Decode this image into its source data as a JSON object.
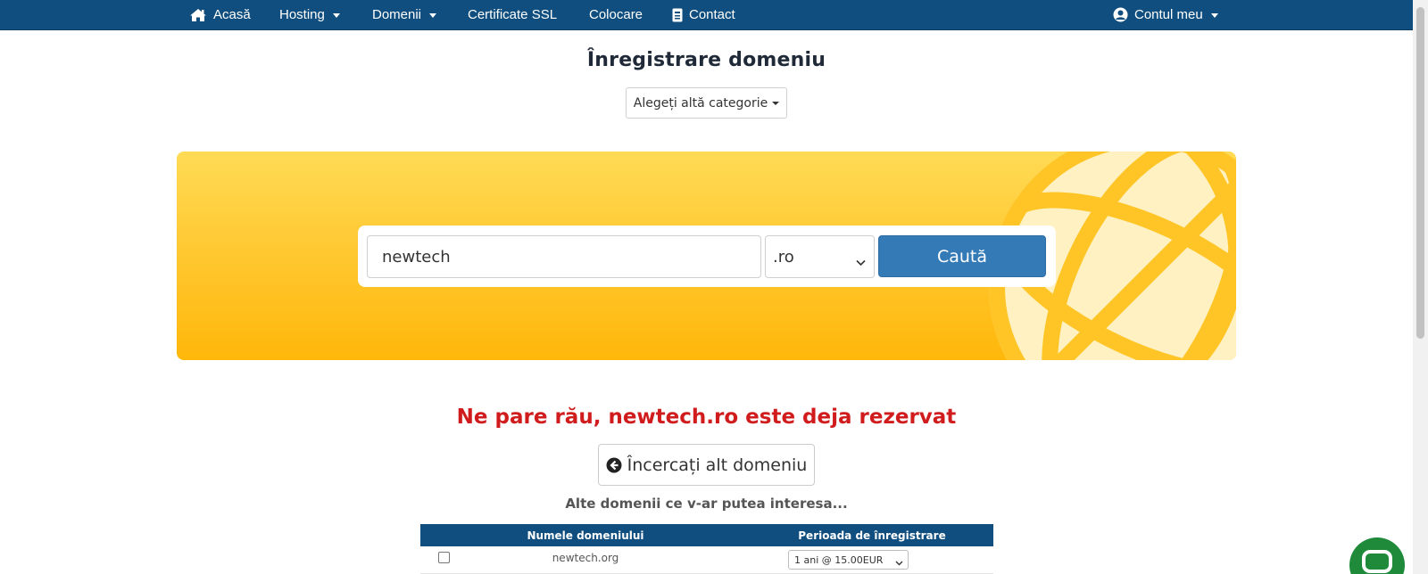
{
  "nav": {
    "home": "Acasă",
    "hosting": "Hosting",
    "domains": "Domenii",
    "ssl": "Certificate SSL",
    "colocation": "Colocare",
    "contact": "Contact",
    "account": "Contul meu"
  },
  "page": {
    "title": "Înregistrare domeniu",
    "category_button": "Alegeți altă categorie"
  },
  "search": {
    "query": "newtech",
    "tld_selected": ".ro",
    "button": "Caută"
  },
  "result": {
    "message": "Ne pare rău, newtech.ro este deja rezervat",
    "try_again": "Încercați alt domeniu",
    "suggestions_title": "Alte domenii ce v-ar putea interesa..."
  },
  "suggestions_table": {
    "headers": [
      "Numele domeniului",
      "Perioada de înregistrare"
    ],
    "rows": [
      {
        "domain": "newtech.org",
        "period": "1 ani @ 15.00EUR",
        "checked": false
      }
    ]
  },
  "colors": {
    "nav_bg": "#0f4e7e",
    "accent_blue": "#337ab7",
    "error_red": "#d01c1c",
    "hero_yellow": "#ffc933",
    "chat_green": "#1f8b3a"
  },
  "icons": [
    "home-icon",
    "chevron-down-icon",
    "contact-card-icon",
    "user-circle-icon",
    "globe-icon",
    "arrow-left-circle-icon",
    "chat-icon"
  ]
}
